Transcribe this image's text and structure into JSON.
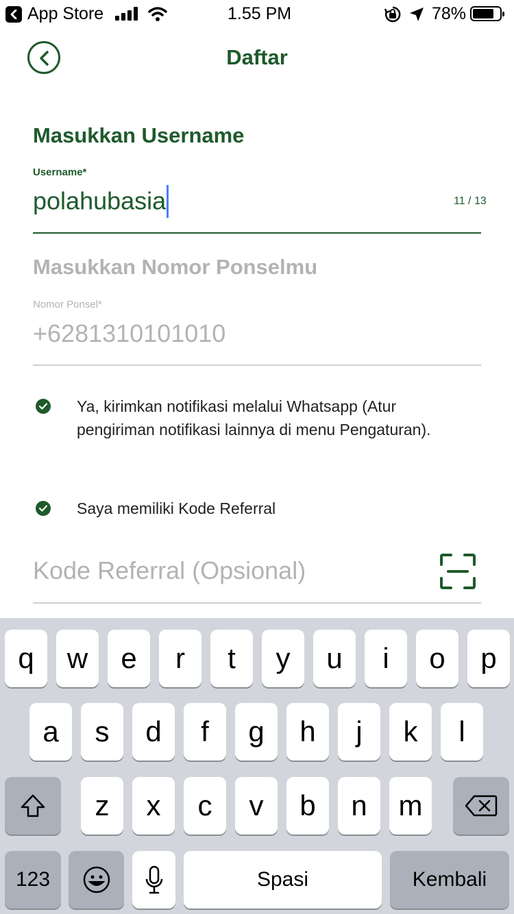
{
  "status_bar": {
    "back_app": "App Store",
    "time": "1.55 PM",
    "battery_percent": "78%",
    "battery_level": 0.78
  },
  "header": {
    "title": "Daftar"
  },
  "username_section": {
    "title": "Masukkan Username",
    "label": "Username*",
    "value": "polahubasia",
    "counter": "11 / 13"
  },
  "phone_section": {
    "title": "Masukkan Nomor Ponselmu",
    "label": "Nomor Ponsel*",
    "placeholder": "+6281310101010"
  },
  "checkboxes": [
    {
      "label": "Ya, kirimkan notifikasi melalui Whatsapp (Atur pengiriman notifikasi lainnya di menu Pengaturan).",
      "checked": true
    },
    {
      "label": "Saya memiliki Kode Referral",
      "checked": true
    }
  ],
  "referral": {
    "placeholder": "Kode Referral (Opsional)"
  },
  "keyboard": {
    "row1": [
      "q",
      "w",
      "e",
      "r",
      "t",
      "y",
      "u",
      "i",
      "o",
      "p"
    ],
    "row2": [
      "a",
      "s",
      "d",
      "f",
      "g",
      "h",
      "j",
      "k",
      "l"
    ],
    "row3": [
      "z",
      "x",
      "c",
      "v",
      "b",
      "n",
      "m"
    ],
    "numbers_key": "123",
    "space_key": "Spasi",
    "return_key": "Kembali"
  },
  "colors": {
    "brand_green": "#1e5a2c",
    "caret_blue": "#4a7fff",
    "muted_gray": "#b3b3b3"
  }
}
